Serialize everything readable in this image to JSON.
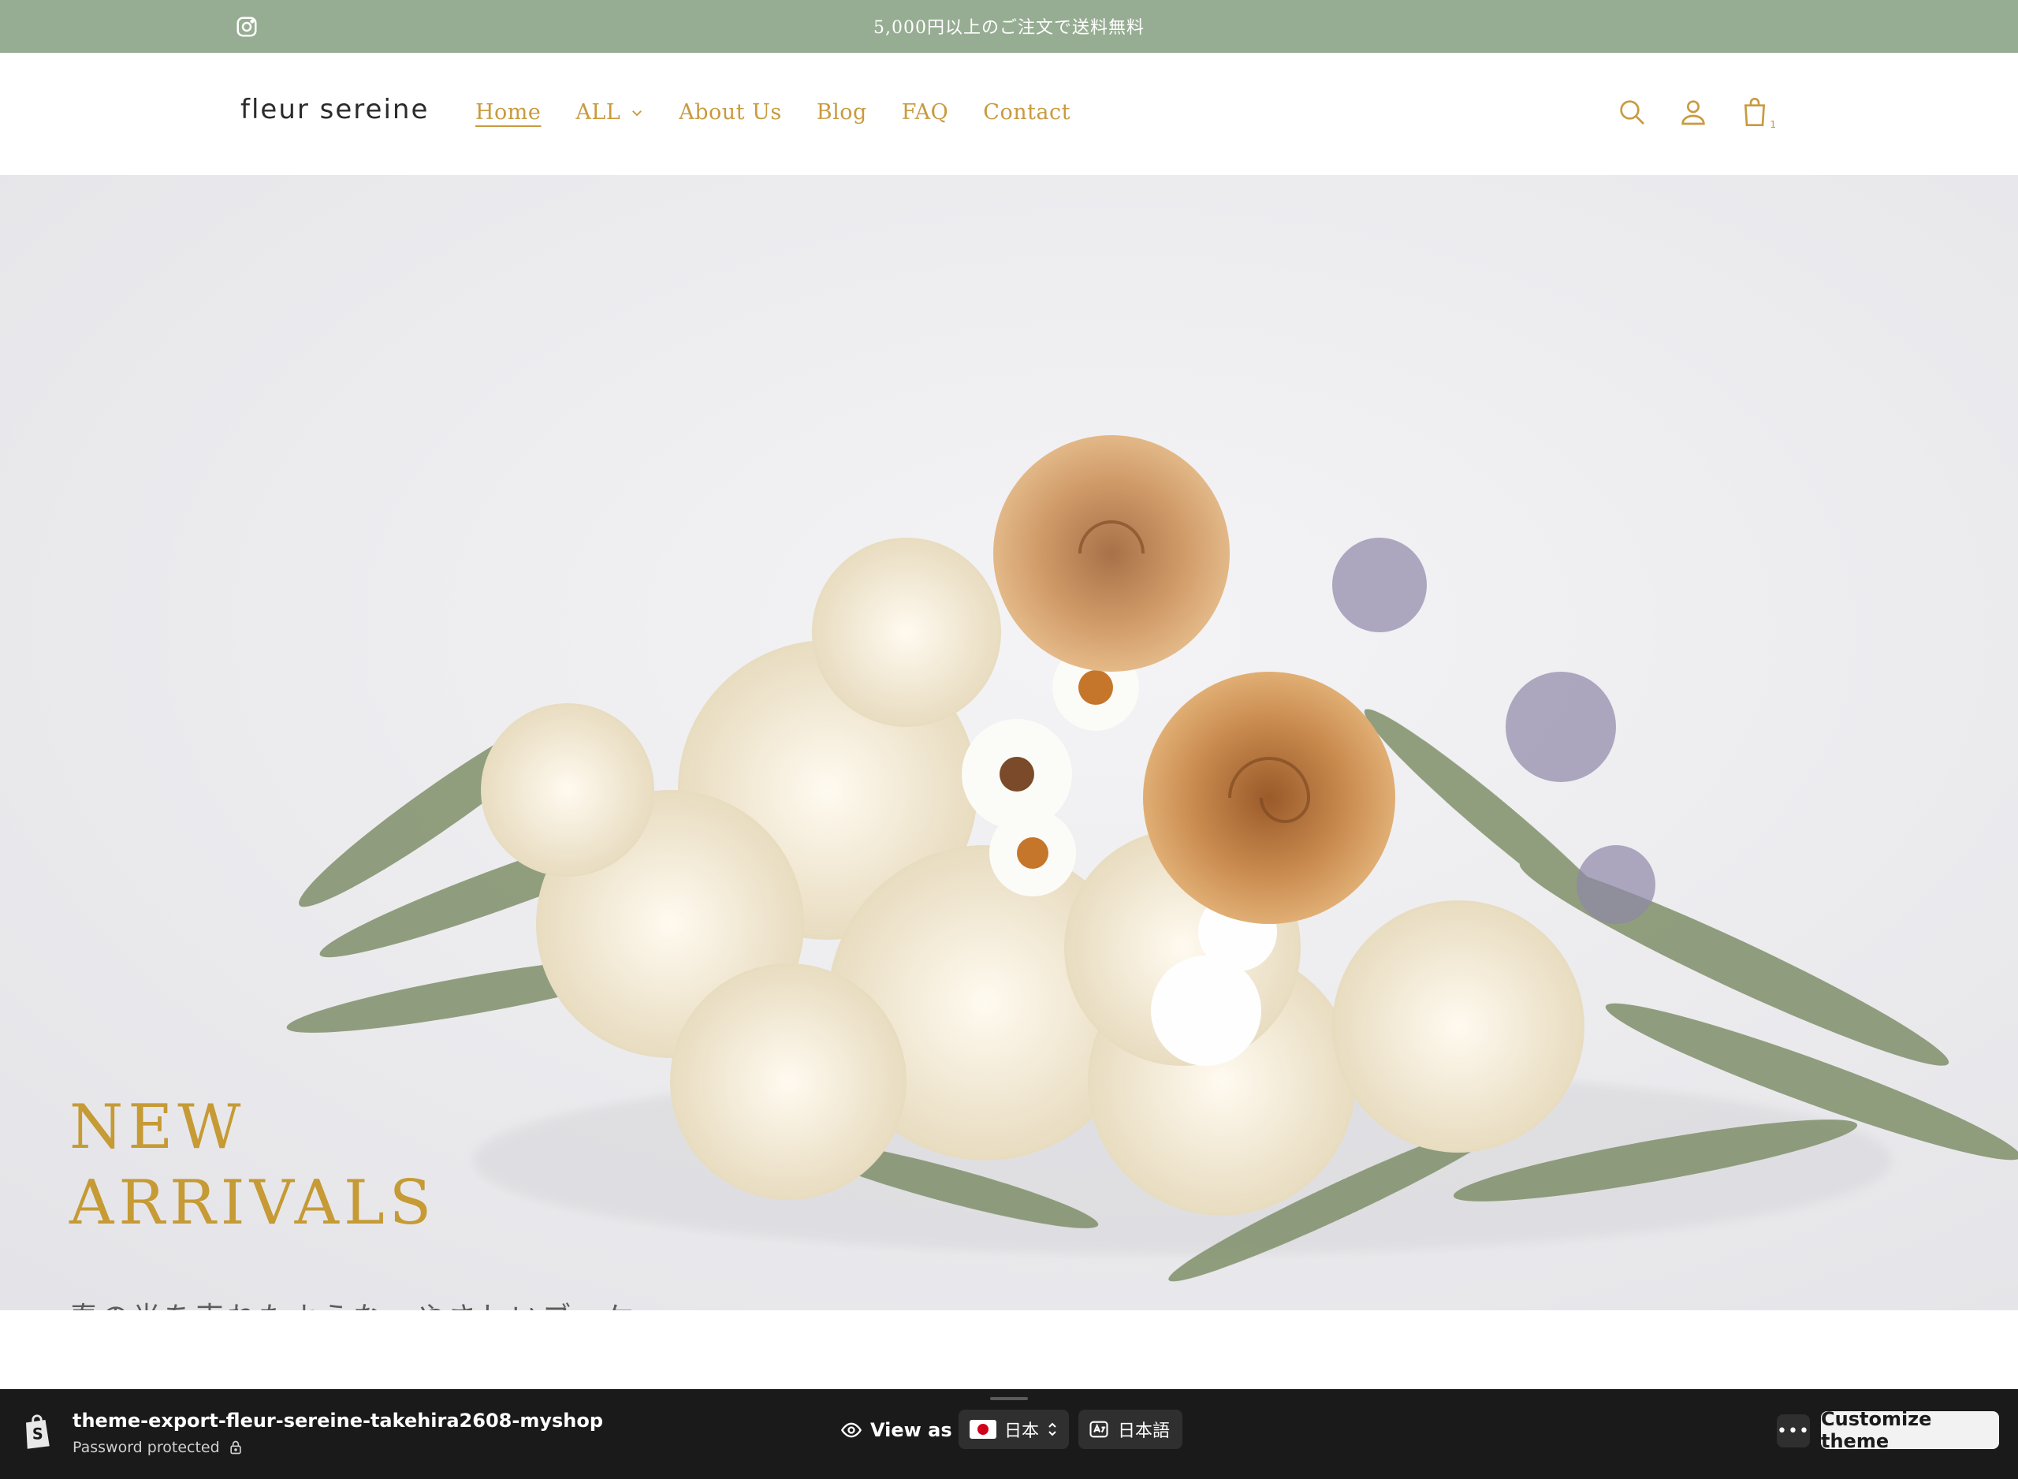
{
  "announcement": {
    "message": "5,000円以上のご注文で送料無料",
    "social_icon": "instagram-icon"
  },
  "header": {
    "logo": "fleur sereine",
    "nav": [
      {
        "label": "Home",
        "active": true
      },
      {
        "label": "ALL",
        "has_dropdown": true
      },
      {
        "label": "About Us"
      },
      {
        "label": "Blog"
      },
      {
        "label": "FAQ"
      },
      {
        "label": "Contact"
      }
    ],
    "icons": [
      "search-icon",
      "account-icon",
      "cart-icon"
    ],
    "cart_count": "1"
  },
  "hero": {
    "title_line1": "NEW",
    "title_line2": "ARRIVALS",
    "subtitle": "春の光を束ねたような、やさしいブーケ。"
  },
  "preview_bar": {
    "store_name": "theme-export-fleur-sereine-takehira2608-myshop",
    "status": "Password protected",
    "view_as_label": "View as",
    "country": "日本",
    "language": "日本語",
    "customize_label": "Customize theme"
  },
  "colors": {
    "announcement_bg": "#97ad93",
    "accent_gold": "#c99a3e",
    "preview_bar_bg": "#1a1a1a"
  }
}
